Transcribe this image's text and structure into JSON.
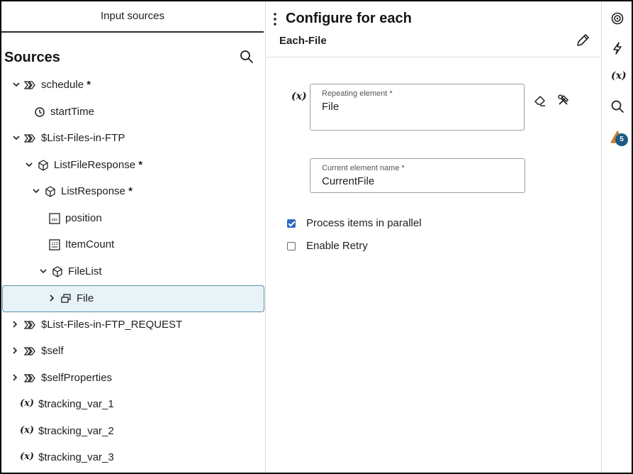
{
  "left_panel": {
    "tab_label": "Input sources",
    "title": "Sources",
    "tree": [
      {
        "label": "schedule",
        "required": "*",
        "icon": "source-icon",
        "chevron": "down"
      },
      {
        "label": "startTime",
        "required": "",
        "icon": "clock-icon",
        "chevron": ""
      },
      {
        "label": "$List-Files-in-FTP",
        "required": "",
        "icon": "source-icon",
        "chevron": "down"
      },
      {
        "label": "ListFileResponse",
        "required": "*",
        "icon": "cube-icon",
        "chevron": "down"
      },
      {
        "label": "ListResponse",
        "required": "*",
        "icon": "cube-icon",
        "chevron": "down"
      },
      {
        "label": "position",
        "required": "",
        "icon": "string-field-icon",
        "chevron": ""
      },
      {
        "label": "ItemCount",
        "required": "",
        "icon": "number-field-icon",
        "chevron": ""
      },
      {
        "label": "FileList",
        "required": "",
        "icon": "cube-icon",
        "chevron": "down"
      },
      {
        "label": "File",
        "required": "",
        "icon": "repeating-element-icon",
        "chevron": "right"
      },
      {
        "label": "$List-Files-in-FTP_REQUEST",
        "required": "",
        "icon": "source-icon",
        "chevron": "right"
      },
      {
        "label": "$self",
        "required": "",
        "icon": "source-icon",
        "chevron": "right"
      },
      {
        "label": "$selfProperties",
        "required": "",
        "icon": "source-icon",
        "chevron": "right"
      },
      {
        "label": "$tracking_var_1",
        "required": "",
        "icon": "variable-icon",
        "chevron": ""
      },
      {
        "label": "$tracking_var_2",
        "required": "",
        "icon": "variable-icon",
        "chevron": ""
      },
      {
        "label": "$tracking_var_3",
        "required": "",
        "icon": "variable-icon",
        "chevron": ""
      }
    ],
    "var_glyph": "(x)"
  },
  "main_panel": {
    "title": "Configure for each",
    "subtitle": "Each-File",
    "repeating_element": {
      "label": "Repeating element *",
      "value": "File"
    },
    "current_element": {
      "label": "Current element name *",
      "value": "CurrentFile"
    },
    "checkboxes": [
      {
        "label": "Process items in parallel",
        "checked": true
      },
      {
        "label": "Enable Retry",
        "checked": false
      }
    ]
  },
  "right_rail": {
    "var_glyph": "(x)",
    "badge_count": "5"
  },
  "colors": {
    "selected_bg": "#e8f3f8",
    "selected_border": "#5a8fa6",
    "checkbox_checked": "#2f6bbd",
    "badge": "#1c5b84"
  }
}
